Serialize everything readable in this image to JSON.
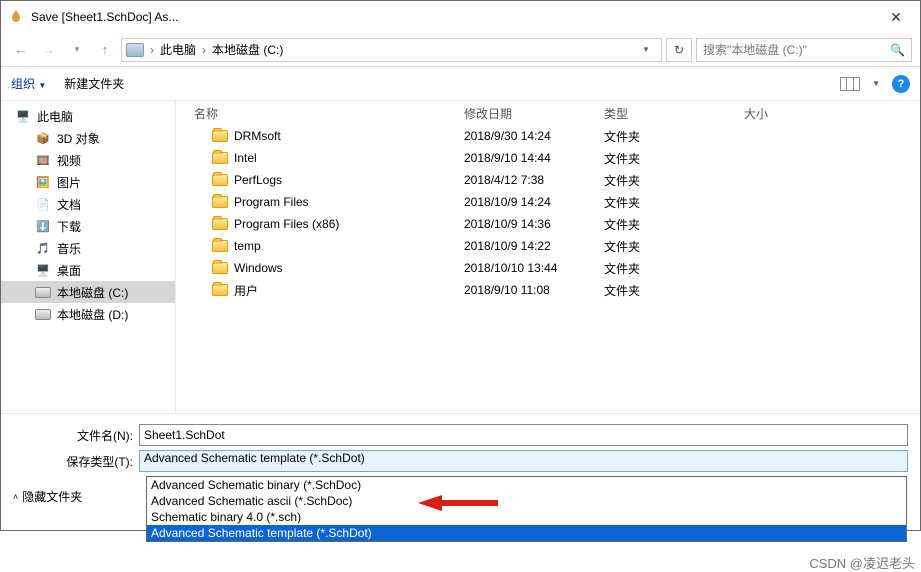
{
  "window": {
    "title": "Save [Sheet1.SchDoc] As..."
  },
  "breadcrumb": {
    "root": "此电脑",
    "drive": "本地磁盘 (C:)"
  },
  "search": {
    "placeholder": "搜索\"本地磁盘 (C:)\""
  },
  "toolbar": {
    "organize": "组织",
    "newfolder": "新建文件夹"
  },
  "tree": {
    "items": [
      {
        "label": "此电脑"
      },
      {
        "label": "3D 对象"
      },
      {
        "label": "视频"
      },
      {
        "label": "图片"
      },
      {
        "label": "文档"
      },
      {
        "label": "下载"
      },
      {
        "label": "音乐"
      },
      {
        "label": "桌面"
      },
      {
        "label": "本地磁盘 (C:)"
      },
      {
        "label": "本地磁盘 (D:)"
      }
    ]
  },
  "columns": {
    "name": "名称",
    "date": "修改日期",
    "type": "类型",
    "size": "大小"
  },
  "rows": [
    {
      "name": "DRMsoft",
      "date": "2018/9/30 14:24",
      "type": "文件夹"
    },
    {
      "name": "Intel",
      "date": "2018/9/10 14:44",
      "type": "文件夹"
    },
    {
      "name": "PerfLogs",
      "date": "2018/4/12 7:38",
      "type": "文件夹"
    },
    {
      "name": "Program Files",
      "date": "2018/10/9 14:24",
      "type": "文件夹"
    },
    {
      "name": "Program Files (x86)",
      "date": "2018/10/9 14:36",
      "type": "文件夹"
    },
    {
      "name": "temp",
      "date": "2018/10/9 14:22",
      "type": "文件夹"
    },
    {
      "name": "Windows",
      "date": "2018/10/10 13:44",
      "type": "文件夹"
    },
    {
      "name": "用户",
      "date": "2018/9/10 11:08",
      "type": "文件夹"
    }
  ],
  "fields": {
    "filename_label": "文件名(N):",
    "filename_value": "Sheet1.SchDot",
    "savetype_label": "保存类型(T):",
    "savetype_value": "Advanced Schematic template (*.SchDot)"
  },
  "dropdown": {
    "options": [
      "Advanced Schematic binary (*.SchDoc)",
      "Advanced Schematic ascii (*.SchDoc)",
      "Schematic binary 4.0 (*.sch)",
      "Advanced Schematic template (*.SchDot)"
    ],
    "highlighted": 3
  },
  "footer": {
    "hide": "隐藏文件夹"
  },
  "watermark": "CSDN @凌迟老头"
}
